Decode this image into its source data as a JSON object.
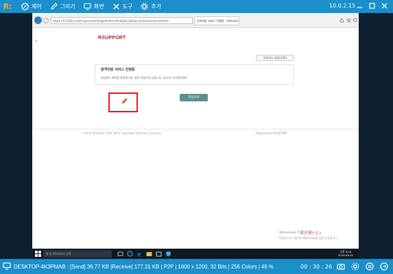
{
  "toolbar": {
    "logo": "R:",
    "control_label": "제어",
    "draw_label": "그리기",
    "screen_label": "화면",
    "tools_label": "도구",
    "more_label": "추가",
    "ip": "10.0.2.15"
  },
  "browser": {
    "address": "https://113366.com/rsup/connecting/result/v-&mobile=&lang=kr&sessionId=default",
    "tab_title": "원격지원 서비스 진행중 - Internet Ex..."
  },
  "page": {
    "arrow": "›",
    "brand": "RSUPPORT",
    "lang_button": "언어모드 변경(선택)",
    "notice_title": "원격지원 서비스 진행중",
    "notice_body": "상담원이 화면을 종료하시면, 창이 자동으로 닫힙니다. 잠시만 기다려주세요.",
    "confirm_button": "처음으로",
    "footer_left": "이용 후 ActiveX는 [프로그램 추가/제거]에서 제거하실 수 있습니다.",
    "footer_right": "Powered by RSUPPORT"
  },
  "remote_os": {
    "activate_title": "Windows 정품 인증",
    "activate_body": "[설정]으로 이동하여 Windows를 정품 인증합니다.",
    "search_placeholder": "웹 및 Windows 검색",
    "clock_time": "오후 5:24",
    "clock_date": "2016-06-21",
    "overlay_text": "원격 제어 중 ▾"
  },
  "status": {
    "text": "DESKTOP-4K3PMAB : [Send] 36.77 KB  [Receive] 177.31 KB | P2P | 1600 x 1200, 32 Bits | 256 Colors | 46 %",
    "timer": "00 : 30 : 26"
  },
  "colors": {
    "viewer_blue": "#1a8fc9",
    "brand_red": "#b01e23",
    "highlight_red": "#e0191f",
    "confirm_green": "#5b8f8f"
  }
}
